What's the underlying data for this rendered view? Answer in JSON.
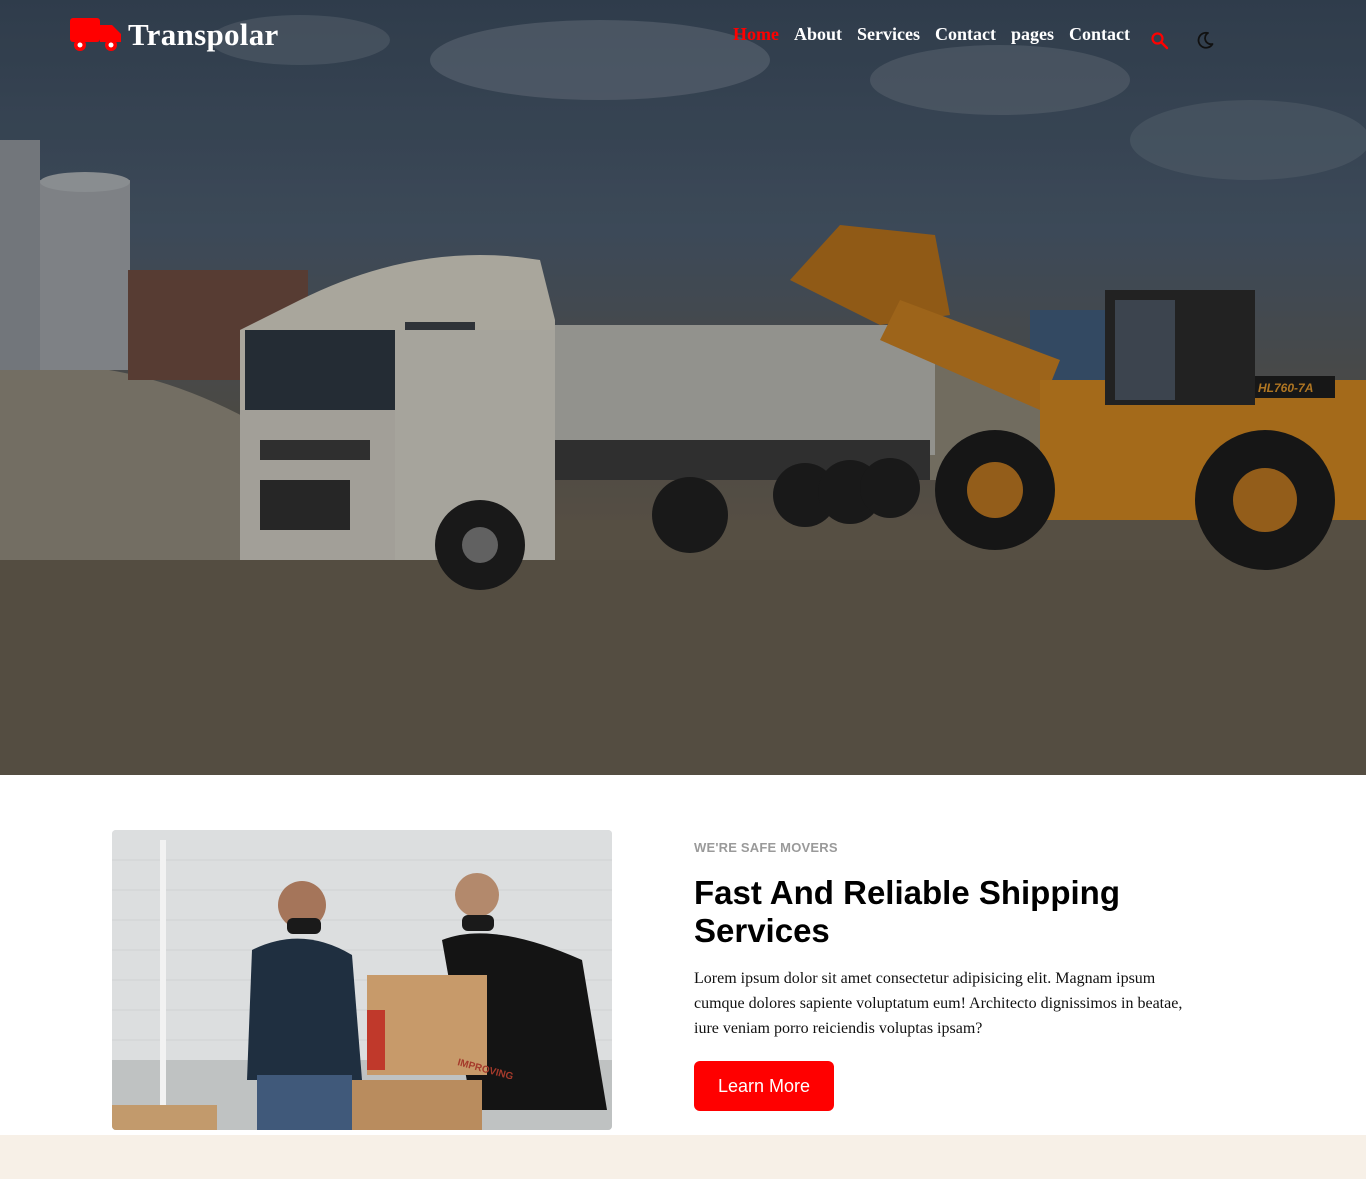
{
  "brand": {
    "name": "Transpolar",
    "icon": "truck-icon",
    "accent": "#ff0000"
  },
  "nav": {
    "items": [
      {
        "label": "Home",
        "active": true
      },
      {
        "label": "About",
        "active": false
      },
      {
        "label": "Services",
        "active": false
      },
      {
        "label": "Contact",
        "active": false
      },
      {
        "label": "pages",
        "active": false
      },
      {
        "label": "Contact",
        "active": false
      }
    ],
    "search_icon": "search-icon",
    "theme_icon": "moon-icon"
  },
  "hero": {
    "image": "dump-truck-and-wheel-loader-photo",
    "loader_plate": "HL760-7A"
  },
  "about": {
    "image": "movers-carrying-boxes-photo",
    "box_label": "IMPROVING",
    "eyebrow": "WE'RE SAFE MOVERS",
    "heading": "Fast And Reliable Shipping Services",
    "description": "Lorem ipsum dolor sit amet consectetur adipisicing elit. Magnam ipsum cumque dolores sapiente voluptatum eum! Architecto dignissimos in beatae, iure veniam porro reiciendis voluptas ipsam?",
    "button_label": "Learn More"
  },
  "colors": {
    "accent": "#ff0000",
    "footer_band": "#f7f0e7",
    "eyebrow": "#9a9a9a"
  }
}
